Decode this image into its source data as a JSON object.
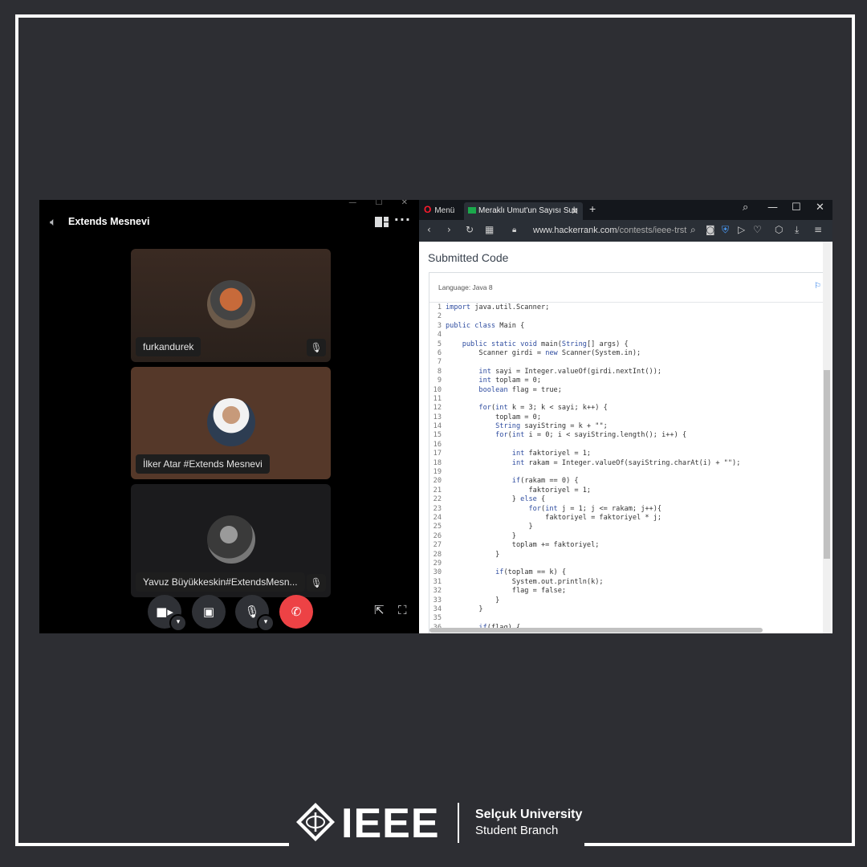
{
  "colors": {
    "background": "#2d2e33",
    "frame": "#ffffff",
    "discord_bg": "#000000",
    "hangup": "#ed4245",
    "link": "#1a73e8"
  },
  "discord": {
    "window_controls": "—  ☐  ✕",
    "channel_icon": "speaker-icon",
    "channel_name": "Extends Mesnevi",
    "participants": [
      {
        "name": "furkandurek",
        "muted": true
      },
      {
        "name": "İlker Atar #Extends Mesnevi",
        "muted": false
      },
      {
        "name": "Yavuz Büyükkeskin#ExtendsMesn...",
        "muted": true
      }
    ],
    "controls": [
      "camera-icon",
      "screen-share-icon",
      "microphone-icon",
      "hang-up-icon"
    ],
    "tools": [
      "popout-icon",
      "fullscreen-icon"
    ]
  },
  "browser": {
    "menu_label": "Menü",
    "tab_title": "Meraklı Umut'un Sayısı Sub",
    "url_host": "www.hackerrank.com",
    "url_path": "/contests/ieee-trst",
    "page_title": "Submitted Code",
    "language_label": "Language: Java 8",
    "code_lines": [
      "import java.util.Scanner;",
      "",
      "public class Main {",
      "",
      "    public static void main(String[] args) {",
      "        Scanner girdi = new Scanner(System.in);",
      "",
      "        int sayi = Integer.valueOf(girdi.nextInt());",
      "        int toplam = 0;",
      "        boolean flag = true;",
      "",
      "        for(int k = 3; k < sayi; k++) {",
      "            toplam = 0;",
      "            String sayiString = k + \"\";",
      "            for(int i = 0; i < sayiString.length(); i++) {",
      "",
      "                int faktoriyel = 1;",
      "                int rakam = Integer.valueOf(sayiString.charAt(i) + \"\");",
      "",
      "                if(rakam == 0) {",
      "                    faktoriyel = 1;",
      "                } else {",
      "                    for(int j = 1; j <= rakam; j++){",
      "                        faktoriyel = faktoriyel * j;",
      "                    }",
      "                }",
      "                toplam += faktoriyel;",
      "            }",
      "",
      "            if(toplam == k) {",
      "                System.out.println(k);",
      "                flag = false;",
      "            }",
      "        }",
      "",
      "        if(flag) {"
    ]
  },
  "branding": {
    "logo_text": "IEEE",
    "org_line1": "Selçuk University",
    "org_line2": "Student Branch"
  }
}
